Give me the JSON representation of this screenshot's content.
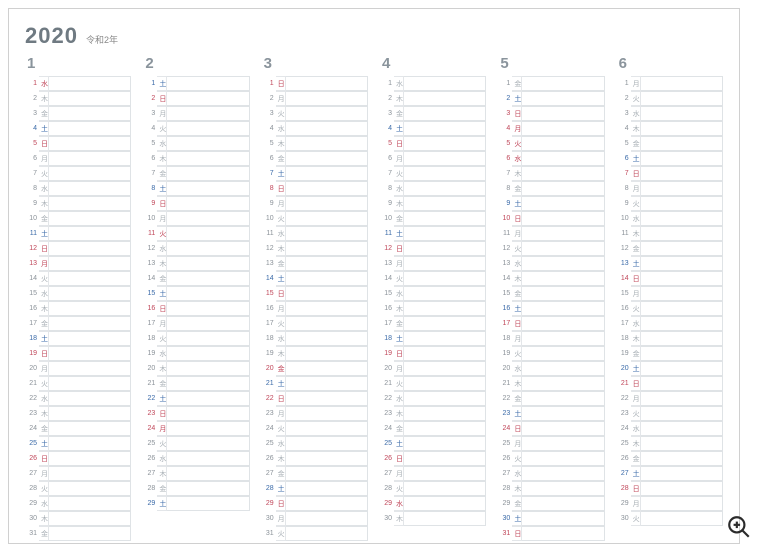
{
  "header": {
    "year": "2020",
    "era": "令和2年"
  },
  "weekday_labels": [
    "日",
    "月",
    "火",
    "水",
    "木",
    "金",
    "土"
  ],
  "months": [
    {
      "label": "1",
      "days": [
        {
          "d": 1,
          "w": 3,
          "t": "hol"
        },
        {
          "d": 2,
          "w": 4
        },
        {
          "d": 3,
          "w": 5
        },
        {
          "d": 4,
          "w": 6,
          "t": "sat"
        },
        {
          "d": 5,
          "w": 0,
          "t": "sun"
        },
        {
          "d": 6,
          "w": 1
        },
        {
          "d": 7,
          "w": 2
        },
        {
          "d": 8,
          "w": 3
        },
        {
          "d": 9,
          "w": 4
        },
        {
          "d": 10,
          "w": 5
        },
        {
          "d": 11,
          "w": 6,
          "t": "sat"
        },
        {
          "d": 12,
          "w": 0,
          "t": "sun"
        },
        {
          "d": 13,
          "w": 1,
          "t": "hol"
        },
        {
          "d": 14,
          "w": 2
        },
        {
          "d": 15,
          "w": 3
        },
        {
          "d": 16,
          "w": 4
        },
        {
          "d": 17,
          "w": 5
        },
        {
          "d": 18,
          "w": 6,
          "t": "sat"
        },
        {
          "d": 19,
          "w": 0,
          "t": "sun"
        },
        {
          "d": 20,
          "w": 1
        },
        {
          "d": 21,
          "w": 2
        },
        {
          "d": 22,
          "w": 3
        },
        {
          "d": 23,
          "w": 4
        },
        {
          "d": 24,
          "w": 5
        },
        {
          "d": 25,
          "w": 6,
          "t": "sat"
        },
        {
          "d": 26,
          "w": 0,
          "t": "sun"
        },
        {
          "d": 27,
          "w": 1
        },
        {
          "d": 28,
          "w": 2
        },
        {
          "d": 29,
          "w": 3
        },
        {
          "d": 30,
          "w": 4
        },
        {
          "d": 31,
          "w": 5
        }
      ]
    },
    {
      "label": "2",
      "days": [
        {
          "d": 1,
          "w": 6,
          "t": "sat"
        },
        {
          "d": 2,
          "w": 0,
          "t": "sun"
        },
        {
          "d": 3,
          "w": 1
        },
        {
          "d": 4,
          "w": 2
        },
        {
          "d": 5,
          "w": 3
        },
        {
          "d": 6,
          "w": 4
        },
        {
          "d": 7,
          "w": 5
        },
        {
          "d": 8,
          "w": 6,
          "t": "sat"
        },
        {
          "d": 9,
          "w": 0,
          "t": "sun"
        },
        {
          "d": 10,
          "w": 1
        },
        {
          "d": 11,
          "w": 2,
          "t": "hol"
        },
        {
          "d": 12,
          "w": 3
        },
        {
          "d": 13,
          "w": 4
        },
        {
          "d": 14,
          "w": 5
        },
        {
          "d": 15,
          "w": 6,
          "t": "sat"
        },
        {
          "d": 16,
          "w": 0,
          "t": "sun"
        },
        {
          "d": 17,
          "w": 1
        },
        {
          "d": 18,
          "w": 2
        },
        {
          "d": 19,
          "w": 3
        },
        {
          "d": 20,
          "w": 4
        },
        {
          "d": 21,
          "w": 5
        },
        {
          "d": 22,
          "w": 6,
          "t": "sat"
        },
        {
          "d": 23,
          "w": 0,
          "t": "hol"
        },
        {
          "d": 24,
          "w": 1,
          "t": "hol"
        },
        {
          "d": 25,
          "w": 2
        },
        {
          "d": 26,
          "w": 3
        },
        {
          "d": 27,
          "w": 4
        },
        {
          "d": 28,
          "w": 5
        },
        {
          "d": 29,
          "w": 6,
          "t": "sat"
        }
      ]
    },
    {
      "label": "3",
      "days": [
        {
          "d": 1,
          "w": 0,
          "t": "sun"
        },
        {
          "d": 2,
          "w": 1
        },
        {
          "d": 3,
          "w": 2
        },
        {
          "d": 4,
          "w": 3
        },
        {
          "d": 5,
          "w": 4
        },
        {
          "d": 6,
          "w": 5
        },
        {
          "d": 7,
          "w": 6,
          "t": "sat"
        },
        {
          "d": 8,
          "w": 0,
          "t": "sun"
        },
        {
          "d": 9,
          "w": 1
        },
        {
          "d": 10,
          "w": 2
        },
        {
          "d": 11,
          "w": 3
        },
        {
          "d": 12,
          "w": 4
        },
        {
          "d": 13,
          "w": 5
        },
        {
          "d": 14,
          "w": 6,
          "t": "sat"
        },
        {
          "d": 15,
          "w": 0,
          "t": "sun"
        },
        {
          "d": 16,
          "w": 1
        },
        {
          "d": 17,
          "w": 2
        },
        {
          "d": 18,
          "w": 3
        },
        {
          "d": 19,
          "w": 4
        },
        {
          "d": 20,
          "w": 5,
          "t": "hol"
        },
        {
          "d": 21,
          "w": 6,
          "t": "sat"
        },
        {
          "d": 22,
          "w": 0,
          "t": "sun"
        },
        {
          "d": 23,
          "w": 1
        },
        {
          "d": 24,
          "w": 2
        },
        {
          "d": 25,
          "w": 3
        },
        {
          "d": 26,
          "w": 4
        },
        {
          "d": 27,
          "w": 5
        },
        {
          "d": 28,
          "w": 6,
          "t": "sat"
        },
        {
          "d": 29,
          "w": 0,
          "t": "sun"
        },
        {
          "d": 30,
          "w": 1
        },
        {
          "d": 31,
          "w": 2
        }
      ]
    },
    {
      "label": "4",
      "days": [
        {
          "d": 1,
          "w": 3
        },
        {
          "d": 2,
          "w": 4
        },
        {
          "d": 3,
          "w": 5
        },
        {
          "d": 4,
          "w": 6,
          "t": "sat"
        },
        {
          "d": 5,
          "w": 0,
          "t": "sun"
        },
        {
          "d": 6,
          "w": 1
        },
        {
          "d": 7,
          "w": 2
        },
        {
          "d": 8,
          "w": 3
        },
        {
          "d": 9,
          "w": 4
        },
        {
          "d": 10,
          "w": 5
        },
        {
          "d": 11,
          "w": 6,
          "t": "sat"
        },
        {
          "d": 12,
          "w": 0,
          "t": "sun"
        },
        {
          "d": 13,
          "w": 1
        },
        {
          "d": 14,
          "w": 2
        },
        {
          "d": 15,
          "w": 3
        },
        {
          "d": 16,
          "w": 4
        },
        {
          "d": 17,
          "w": 5
        },
        {
          "d": 18,
          "w": 6,
          "t": "sat"
        },
        {
          "d": 19,
          "w": 0,
          "t": "sun"
        },
        {
          "d": 20,
          "w": 1
        },
        {
          "d": 21,
          "w": 2
        },
        {
          "d": 22,
          "w": 3
        },
        {
          "d": 23,
          "w": 4
        },
        {
          "d": 24,
          "w": 5
        },
        {
          "d": 25,
          "w": 6,
          "t": "sat"
        },
        {
          "d": 26,
          "w": 0,
          "t": "sun"
        },
        {
          "d": 27,
          "w": 1
        },
        {
          "d": 28,
          "w": 2
        },
        {
          "d": 29,
          "w": 3,
          "t": "hol"
        },
        {
          "d": 30,
          "w": 4
        }
      ]
    },
    {
      "label": "5",
      "days": [
        {
          "d": 1,
          "w": 5
        },
        {
          "d": 2,
          "w": 6,
          "t": "sat"
        },
        {
          "d": 3,
          "w": 0,
          "t": "hol"
        },
        {
          "d": 4,
          "w": 1,
          "t": "hol"
        },
        {
          "d": 5,
          "w": 2,
          "t": "hol"
        },
        {
          "d": 6,
          "w": 3,
          "t": "hol"
        },
        {
          "d": 7,
          "w": 4
        },
        {
          "d": 8,
          "w": 5
        },
        {
          "d": 9,
          "w": 6,
          "t": "sat"
        },
        {
          "d": 10,
          "w": 0,
          "t": "sun"
        },
        {
          "d": 11,
          "w": 1
        },
        {
          "d": 12,
          "w": 2
        },
        {
          "d": 13,
          "w": 3
        },
        {
          "d": 14,
          "w": 4
        },
        {
          "d": 15,
          "w": 5
        },
        {
          "d": 16,
          "w": 6,
          "t": "sat"
        },
        {
          "d": 17,
          "w": 0,
          "t": "sun"
        },
        {
          "d": 18,
          "w": 1
        },
        {
          "d": 19,
          "w": 2
        },
        {
          "d": 20,
          "w": 3
        },
        {
          "d": 21,
          "w": 4
        },
        {
          "d": 22,
          "w": 5
        },
        {
          "d": 23,
          "w": 6,
          "t": "sat"
        },
        {
          "d": 24,
          "w": 0,
          "t": "sun"
        },
        {
          "d": 25,
          "w": 1
        },
        {
          "d": 26,
          "w": 2
        },
        {
          "d": 27,
          "w": 3
        },
        {
          "d": 28,
          "w": 4
        },
        {
          "d": 29,
          "w": 5
        },
        {
          "d": 30,
          "w": 6,
          "t": "sat"
        },
        {
          "d": 31,
          "w": 0,
          "t": "sun"
        }
      ]
    },
    {
      "label": "6",
      "days": [
        {
          "d": 1,
          "w": 1
        },
        {
          "d": 2,
          "w": 2
        },
        {
          "d": 3,
          "w": 3
        },
        {
          "d": 4,
          "w": 4
        },
        {
          "d": 5,
          "w": 5
        },
        {
          "d": 6,
          "w": 6,
          "t": "sat"
        },
        {
          "d": 7,
          "w": 0,
          "t": "sun"
        },
        {
          "d": 8,
          "w": 1
        },
        {
          "d": 9,
          "w": 2
        },
        {
          "d": 10,
          "w": 3
        },
        {
          "d": 11,
          "w": 4
        },
        {
          "d": 12,
          "w": 5
        },
        {
          "d": 13,
          "w": 6,
          "t": "sat"
        },
        {
          "d": 14,
          "w": 0,
          "t": "sun"
        },
        {
          "d": 15,
          "w": 1
        },
        {
          "d": 16,
          "w": 2
        },
        {
          "d": 17,
          "w": 3
        },
        {
          "d": 18,
          "w": 4
        },
        {
          "d": 19,
          "w": 5
        },
        {
          "d": 20,
          "w": 6,
          "t": "sat"
        },
        {
          "d": 21,
          "w": 0,
          "t": "sun"
        },
        {
          "d": 22,
          "w": 1
        },
        {
          "d": 23,
          "w": 2
        },
        {
          "d": 24,
          "w": 3
        },
        {
          "d": 25,
          "w": 4
        },
        {
          "d": 26,
          "w": 5
        },
        {
          "d": 27,
          "w": 6,
          "t": "sat"
        },
        {
          "d": 28,
          "w": 0,
          "t": "sun"
        },
        {
          "d": 29,
          "w": 1
        },
        {
          "d": 30,
          "w": 2
        }
      ]
    }
  ],
  "zoom": {
    "title": "zoom"
  }
}
